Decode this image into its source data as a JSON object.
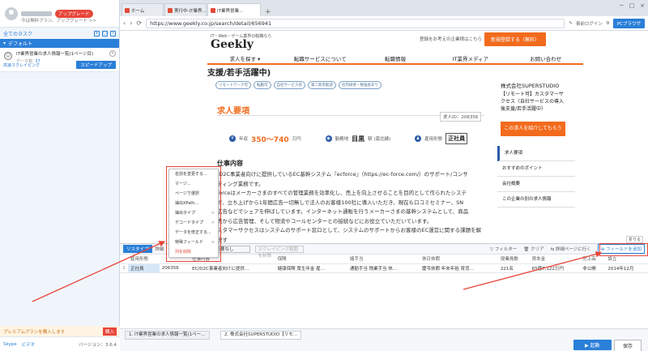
{
  "sidebar": {
    "upgrade": "アップグレード",
    "tagline": "今は無料プラン、アップグレード >>",
    "all_tasks": "全てのタスク",
    "default_group": "デフォルト",
    "task": {
      "title": "IT業界営業の求人情報一覧(1ページ目)",
      "meta_label": "データ数:",
      "meta_value": "37",
      "mode": "高速スクレイピング",
      "speed_button": "スピードアップ"
    },
    "premium": "プレミアムプランを購入します",
    "buy": "購入",
    "bottom": {
      "skype": "Skype",
      "video": "ビデオ",
      "version": "バージョン：3.6.4"
    }
  },
  "browser": {
    "tabs": [
      "ホーム",
      "実行中-IT業界…",
      "IT業界営業…"
    ],
    "url": "https://www.geekly.co.jp/search/detail/656941",
    "addr_right": "事前ログイン",
    "pc_browser": "PCブラウザ"
  },
  "page": {
    "logo_sub": "IT・Web・ゲーム業界の転職なら",
    "logo": "Geekly",
    "head_right": "登録をお考えの企業様はこちら",
    "register": "新規登録する（無料）",
    "nav": [
      "求人を探す ▾",
      "転職サービスについて",
      "転職情報",
      "IT業界メディア",
      "お問い合わせ"
    ],
    "job_title": "支援/若手活躍中)",
    "tags": [
      "リモートワーク可",
      "転勤可",
      "自社サービス有",
      "第二新卒歓迎",
      "社内研修・勉強会あり"
    ],
    "section_head": "求人要項",
    "job_id": "求人ID：206356",
    "summary": {
      "salary_label": "年収",
      "salary": "350〜740",
      "salary_unit": "万円",
      "location_label": "勤務地",
      "location": "目黒",
      "location_suffix": "駅 (南北線)",
      "employment_label": "雇用形態",
      "employment": "正社員"
    },
    "work_head": "仕事内容",
    "work_lines": [
      "/D2C事業者向けに提供しているEC基幹システム『ecforce』（https://ec-force.com/）のサポート/コンサ",
      "ティング業務です。",
      "forceはメーカーさまのすべての管理業務を効率化し、売上を向上させることを目的として作られたシステ",
      "で、立ち上げから1年間広告一切無しで法人のお客様100社に導入いただき、現在も口コミセミナー、SN",
      "広告などでシェアを伸ばしています。インターネット通販を行うメーカーさまの基幹システムとして、商品",
      "売から広告管理、そして物流やコールセンターとの接続などにお役立ていただいています。",
      "スタマーサクセスはシステムのサポート窓口として、システムのサポートからお客様のEC運営に関する課題を解決す"
    ],
    "company": "株式会社SUPERSTUDIO",
    "promo": "【リモート可】カスタマーサクセス（自社サービスの導入後支援/若手活躍中）",
    "introduce": "この求人を紹介してもらう",
    "side_menu": [
      "求人要項",
      "おすすめのポイント",
      "会社概要",
      "この企業の別の求人情報"
    ]
  },
  "context_menu": [
    "名前を変更する...",
    "マージ...",
    "ページで選択",
    "抽出XPath...",
    "抽出タイプ",
    "デコードタイプ",
    "データを修正する...",
    "特殊フィールド",
    "列を削除"
  ],
  "datapanel": {
    "type_btn": "リスタイプ",
    "detail": "詳細",
    "select_value": "必要なし",
    "dedupe": "スクレイピング範囲を制限",
    "filter": "フィルター",
    "clear": "クリア",
    "detail_page": "詳細ページに行く",
    "add_field": "フィールドを追加",
    "fold": "折りる",
    "columns": [
      "",
      "雇用形態",
      "",
      "仕事内容",
      "保険",
      "諸手当",
      "休日休暇",
      "授業員数",
      "資本金",
      "売上高",
      "設立"
    ],
    "row": [
      "1",
      "正社員",
      "206356",
      "EC/D2C事業者向けに提供…",
      "健康保険 厚生年金 雇…",
      "通勤手当 残業手当 休…",
      "慶弔休暇 年末年始 育児…",
      "221名",
      "65億7,122万円",
      "非公開",
      "2014年12月"
    ]
  },
  "taskbar": {
    "tab1": "1. IT業界営業の求人情報一覧(1ペー…",
    "tab2": "2. 株式会社SUPERSTUDIO【リモ…",
    "start": "起動",
    "save": "保存"
  },
  "colors": {
    "accent": "#2a7fd8",
    "brand_orange": "#f26b1d",
    "annotation_red": "#e8463a"
  }
}
